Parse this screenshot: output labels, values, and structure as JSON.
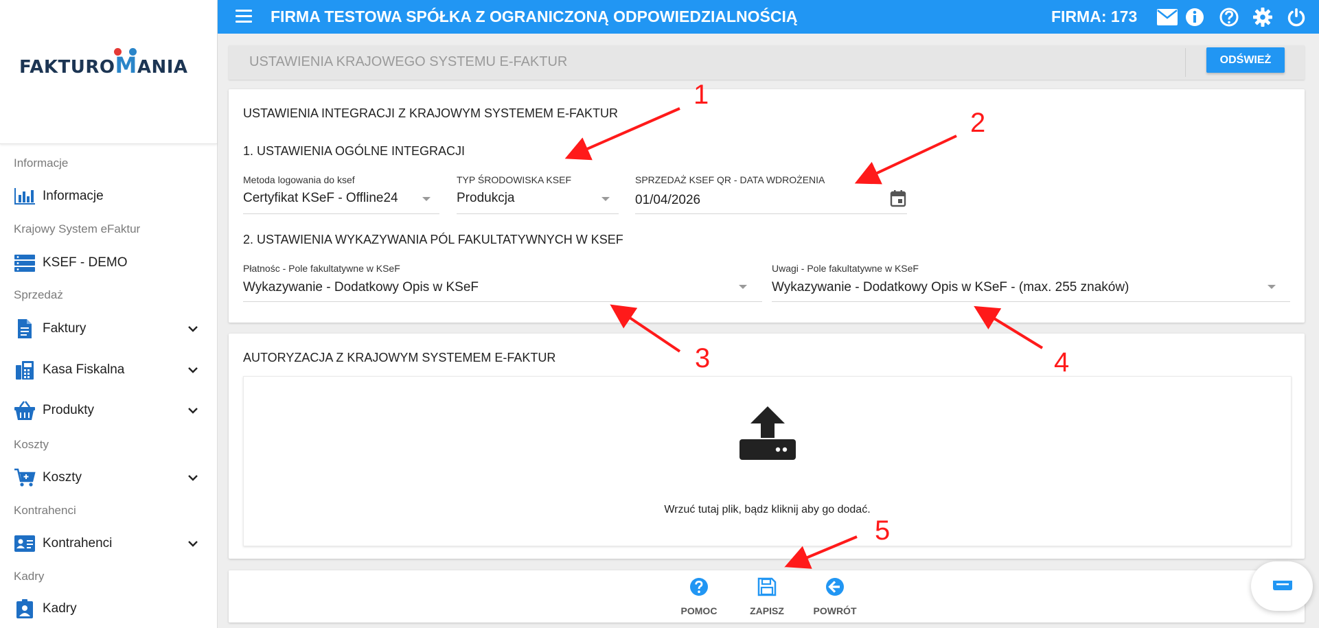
{
  "app": {
    "logo_text_left": "FAKTURO",
    "logo_text_m": "M",
    "logo_text_right": "ANIA",
    "company_title": "FIRMA TESTOWA SPÓŁKA Z OGRANICZONĄ ODPOWIEDZIALNOŚCIĄ",
    "firma_label": "FIRMA: 173",
    "accent_color": "#2196f3",
    "top_icons": [
      "mail-icon",
      "info-icon",
      "help-icon",
      "settings-icon",
      "power-icon"
    ]
  },
  "sidebar": {
    "sections": [
      {
        "label": "Informacje",
        "items": [
          {
            "label": "Informacje",
            "icon": "bar-chart-icon",
            "expandable": false
          }
        ]
      },
      {
        "label": "Krajowy System eFaktur",
        "items": [
          {
            "label": "KSEF - DEMO",
            "icon": "server-icon",
            "expandable": false
          }
        ]
      },
      {
        "label": "Sprzedaż",
        "items": [
          {
            "label": "Faktury",
            "icon": "document-icon",
            "expandable": true
          },
          {
            "label": "Kasa Fiskalna",
            "icon": "cash-register-icon",
            "expandable": true
          },
          {
            "label": "Produkty",
            "icon": "basket-icon",
            "expandable": true
          }
        ]
      },
      {
        "label": "Koszty",
        "items": [
          {
            "label": "Koszty",
            "icon": "cart-add-icon",
            "expandable": true
          }
        ]
      },
      {
        "label": "Kontrahenci",
        "items": [
          {
            "label": "Kontrahenci",
            "icon": "contact-card-icon",
            "expandable": true
          }
        ]
      },
      {
        "label": "Kadry",
        "items": [
          {
            "label": "Kadry",
            "icon": "person-badge-icon",
            "expandable": false
          }
        ]
      }
    ]
  },
  "panel": {
    "title": "USTAWIENIA KRAJOWEGO SYSTEMU E-FAKTUR",
    "refresh_label": "ODŚWIEŻ"
  },
  "integration": {
    "heading": "USTAWIENIA INTEGRACJI Z KRAJOWYM SYSTEMEM E-FAKTUR",
    "general_heading": "1. USTAWIENIA OGÓLNE INTEGRACJI",
    "login_method": {
      "label": "Metoda logowania do ksef",
      "value": "Certyfikat KSeF - Offline24"
    },
    "environment": {
      "label": "TYP ŚRODOWISKA KSEF",
      "value": "Produkcja"
    },
    "qr_date": {
      "label": "SPRZEDAŻ KSEF QR - DATA WDROŻENIA",
      "value": "01/04/2026"
    },
    "optional_heading": "2. USTAWIENIA WYKAZYWANIA PÓL FAKULTATYWNYCH W KSEF",
    "payment_field": {
      "label": "Płatnośc - Pole fakultatywne w KSeF",
      "value": "Wykazywanie - Dodatkowy Opis w KSeF"
    },
    "remarks_field": {
      "label": "Uwagi - Pole fakultatywne w KSeF",
      "value": "Wykazywanie - Dodatkowy Opis w KSeF - (max. 255 znaków)"
    }
  },
  "authorization": {
    "heading": "AUTORYZACJA Z KRAJOWYM SYSTEMEM E-FAKTUR",
    "dropzone_text": "Wrzuć tutaj plik, bądz kliknij aby go dodać."
  },
  "actions": {
    "help_label": "POMOC",
    "save_label": "ZAPISZ",
    "back_label": "POWRÓT"
  },
  "annotations": {
    "color": "#ff1a1a",
    "labels": [
      "1",
      "2",
      "3",
      "4",
      "5"
    ]
  }
}
